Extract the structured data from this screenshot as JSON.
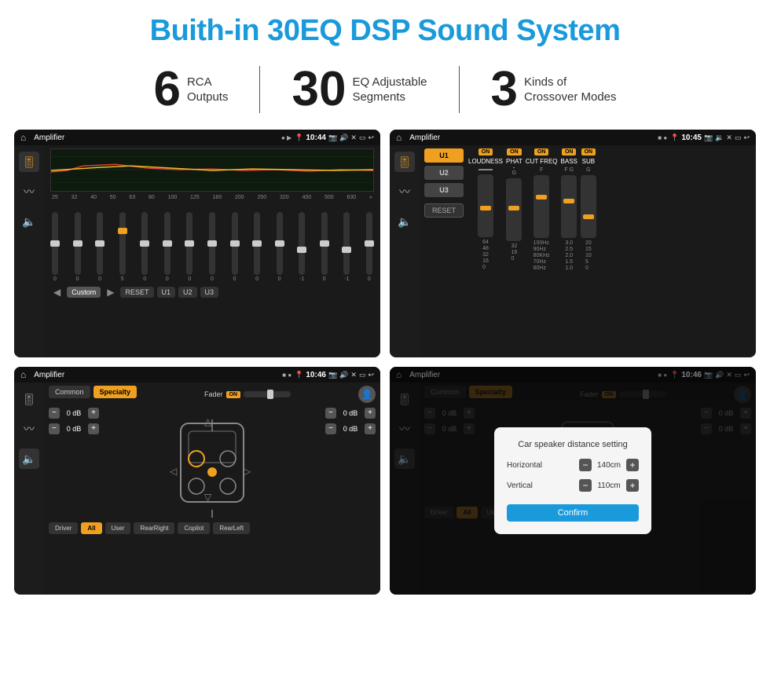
{
  "page": {
    "title": "Buith-in 30EQ DSP Sound System",
    "bg_color": "#ffffff"
  },
  "stats": [
    {
      "number": "6",
      "label": "RCA\nOutputs"
    },
    {
      "number": "30",
      "label": "EQ Adjustable\nSegments"
    },
    {
      "number": "3",
      "label": "Kinds of\nCrossover Modes"
    }
  ],
  "screens": [
    {
      "id": "screen1",
      "status_bar": {
        "title": "Amplifier",
        "time": "10:44"
      },
      "type": "eq"
    },
    {
      "id": "screen2",
      "status_bar": {
        "title": "Amplifier",
        "time": "10:45"
      },
      "type": "amp"
    },
    {
      "id": "screen3",
      "status_bar": {
        "title": "Amplifier",
        "time": "10:46"
      },
      "type": "crossover"
    },
    {
      "id": "screen4",
      "status_bar": {
        "title": "Amplifier",
        "time": "10:46"
      },
      "type": "crossover-dialog"
    }
  ],
  "eq": {
    "freqs": [
      "25",
      "32",
      "40",
      "50",
      "63",
      "80",
      "100",
      "125",
      "160",
      "200",
      "250",
      "320",
      "400",
      "500",
      "630"
    ],
    "values": [
      "0",
      "0",
      "0",
      "5",
      "0",
      "0",
      "0",
      "0",
      "0",
      "0",
      "0",
      "-1",
      "0",
      "-1",
      "0"
    ],
    "presets": [
      "Custom",
      "RESET",
      "U1",
      "U2",
      "U3"
    ]
  },
  "amp_presets": [
    "U1",
    "U2",
    "U3"
  ],
  "amp_controls": [
    {
      "label": "LOUDNESS",
      "on": true
    },
    {
      "label": "PHAT",
      "on": true
    },
    {
      "label": "CUT FREQ",
      "on": true
    },
    {
      "label": "BASS",
      "on": true
    },
    {
      "label": "SUB",
      "on": true
    }
  ],
  "crossover": {
    "tabs": [
      "Common",
      "Specialty"
    ],
    "fader_label": "Fader",
    "fader_on": "ON",
    "speaker_positions": [
      "Driver",
      "Copilot",
      "RearLeft",
      "RearRight",
      "All",
      "User"
    ],
    "speaker_values": [
      "-0 dB",
      "-0 dB",
      "-0 dB",
      "-0 dB"
    ]
  },
  "dialog": {
    "title": "Car speaker distance setting",
    "horizontal_label": "Horizontal",
    "horizontal_value": "140cm",
    "vertical_label": "Vertical",
    "vertical_value": "110cm",
    "confirm_label": "Confirm"
  },
  "icons": {
    "home": "⌂",
    "location": "📍",
    "settings": "≡",
    "back": "↩",
    "volume": "🔊",
    "close": "✕",
    "window": "▭",
    "eq_icon": "🎚",
    "wave_icon": "〰",
    "speaker_icon": "🔈",
    "chevron_right": "»",
    "play": "▶",
    "prev": "◀",
    "next": "▶",
    "camera": "📷",
    "user": "👤"
  }
}
